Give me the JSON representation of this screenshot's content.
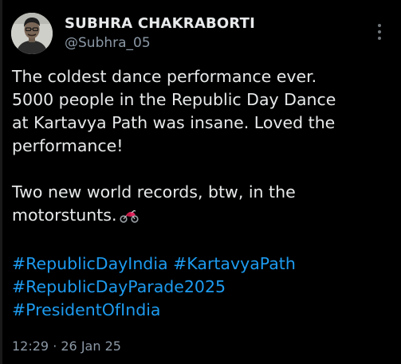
{
  "author": {
    "display_name": "SUBHRA CHAKRABORTI",
    "handle": "@Subhra_05",
    "avatar_icon": "profile-photo"
  },
  "tweet": {
    "lines": [
      "The coldest dance performance ever.",
      "5000 people in the Republic Day Dance",
      "at Kartavya Path was insane. Loved the",
      "performance!"
    ],
    "lines2": [
      "Two new world records, btw, in the",
      "motorstunts."
    ],
    "emoji_icon": "motorcycle-icon",
    "hashtags": [
      "#RepublicDayIndia",
      "#KartavyaPath",
      "#RepublicDayParade2025",
      "#PresidentOfIndia"
    ]
  },
  "meta": {
    "timestamp": "12:29 · 26 Jan 25"
  },
  "colors": {
    "background": "#000000",
    "text": "#e7e9ea",
    "muted": "#8b98a5",
    "link": "#1d9bf0"
  }
}
